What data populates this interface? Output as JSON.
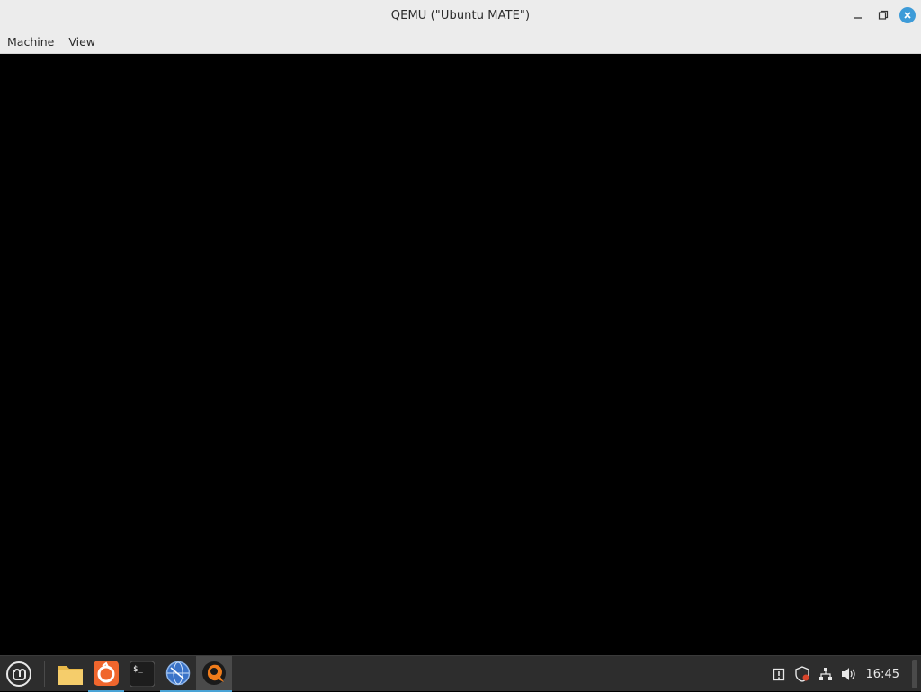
{
  "window": {
    "title": "QEMU (\"Ubuntu MATE\")",
    "controls": {
      "minimize_icon": "minimize-icon",
      "maximize_icon": "restore-icon",
      "close_icon": "close-icon",
      "close_color": "#3d9bd8"
    }
  },
  "menubar": {
    "items": [
      {
        "label": "Machine"
      },
      {
        "label": "View"
      }
    ]
  },
  "guest_screen": {
    "background": "#000000"
  },
  "taskbar": {
    "background": "#2d2d2d",
    "accent": "#49a3d6",
    "menu_icon": "linux-mint-menu-icon",
    "launchers": [
      {
        "name": "files",
        "icon": "folder-icon",
        "active": false
      },
      {
        "name": "firefox",
        "icon": "firefox-icon",
        "active": true
      },
      {
        "name": "terminal",
        "icon": "terminal-icon",
        "active": false
      },
      {
        "name": "network-browser",
        "icon": "globe-icon",
        "active": true
      },
      {
        "name": "qemu",
        "icon": "qemu-icon",
        "active": true,
        "focused": true
      }
    ],
    "tray": {
      "icons": [
        "clipboard-alert-icon",
        "shield-icon",
        "network-icon",
        "volume-icon"
      ],
      "clock": "16:45"
    }
  }
}
